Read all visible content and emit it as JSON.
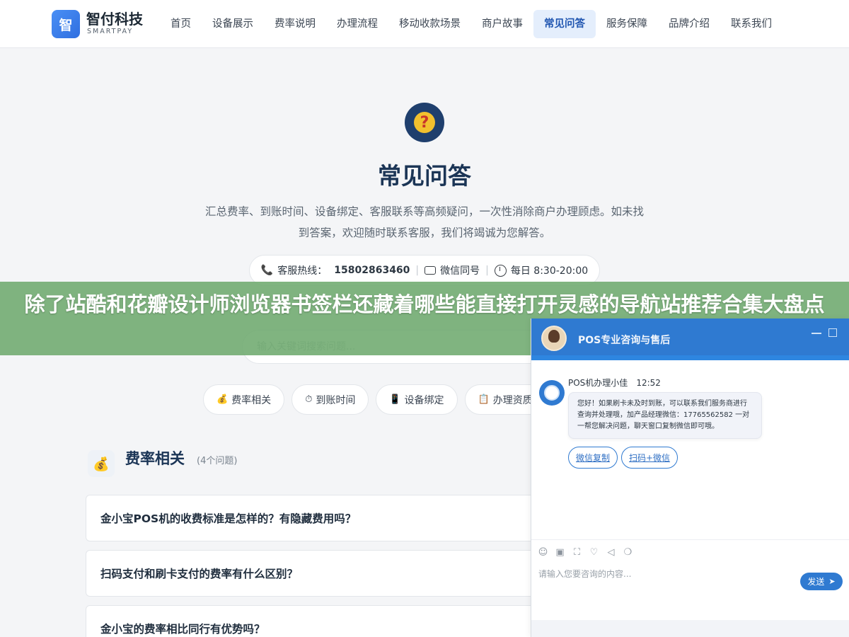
{
  "header": {
    "logo_char": "智",
    "brand_name": "智付科技",
    "brand_sub": "SMARTPAY",
    "nav": [
      {
        "label": "首页"
      },
      {
        "label": "设备展示"
      },
      {
        "label": "费率说明"
      },
      {
        "label": "办理流程"
      },
      {
        "label": "移动收款场景"
      },
      {
        "label": "商户故事"
      },
      {
        "label": "常见问答",
        "active": true
      },
      {
        "label": "服务保障"
      },
      {
        "label": "品牌介绍"
      },
      {
        "label": "联系我们"
      }
    ]
  },
  "hero": {
    "icon_glyph": "?",
    "title": "常见问答",
    "description": "汇总费率、到账时间、设备绑定、客服联系等高频疑问，一次性消除商户办理顾虑。如未找到答案，欢迎随时联系客服，我们将竭诚为您解答。",
    "contact": {
      "hotline_label": "客服热线：",
      "hotline_number": "15802863460",
      "wechat_label": "微信同号",
      "hours_label": "每日 8:30-20:00"
    }
  },
  "search": {
    "placeholder": "输入关键词搜索问题..."
  },
  "chips": [
    {
      "icon": "💰",
      "label": "费率相关"
    },
    {
      "icon": "⏱",
      "label": "到账时间"
    },
    {
      "icon": "📱",
      "label": "设备绑定"
    },
    {
      "icon": "📋",
      "label": "办理资质"
    }
  ],
  "section": {
    "icon": "💰",
    "title": "费率相关",
    "count": "(4个问题)"
  },
  "faqs": [
    {
      "question": "金小宝POS机的收费标准是怎样的？有隐藏费用吗？"
    },
    {
      "question": "扫码支付和刷卡支付的费率有什么区别？"
    },
    {
      "question": "金小宝的费率相比同行有优势吗？"
    }
  ],
  "banner": {
    "text": "除了站酷和花瓣设计师浏览器书签栏还藏着哪些能直接打开灵感的导航站推荐合集大盘点"
  },
  "chat": {
    "title": "POS专业咨询与售后",
    "agent_name": "POS机办理小佳",
    "time": "12:52",
    "message": "您好！如果刷卡未及时到账，可以联系我们服务商进行查询并处理哦，加产品经理微信：17765562582 一对一帮您解决问题，聊天窗口复制微信即可哦。",
    "quick_replies": [
      {
        "label": "微信复制"
      },
      {
        "label": "扫码+微信"
      }
    ],
    "input_placeholder": "请输入您要咨询的内容...",
    "send_label": "发送",
    "tools": [
      "emoji-icon",
      "image-icon",
      "screenshot-icon",
      "rating-icon",
      "sound-icon",
      "chat-history-icon"
    ]
  }
}
